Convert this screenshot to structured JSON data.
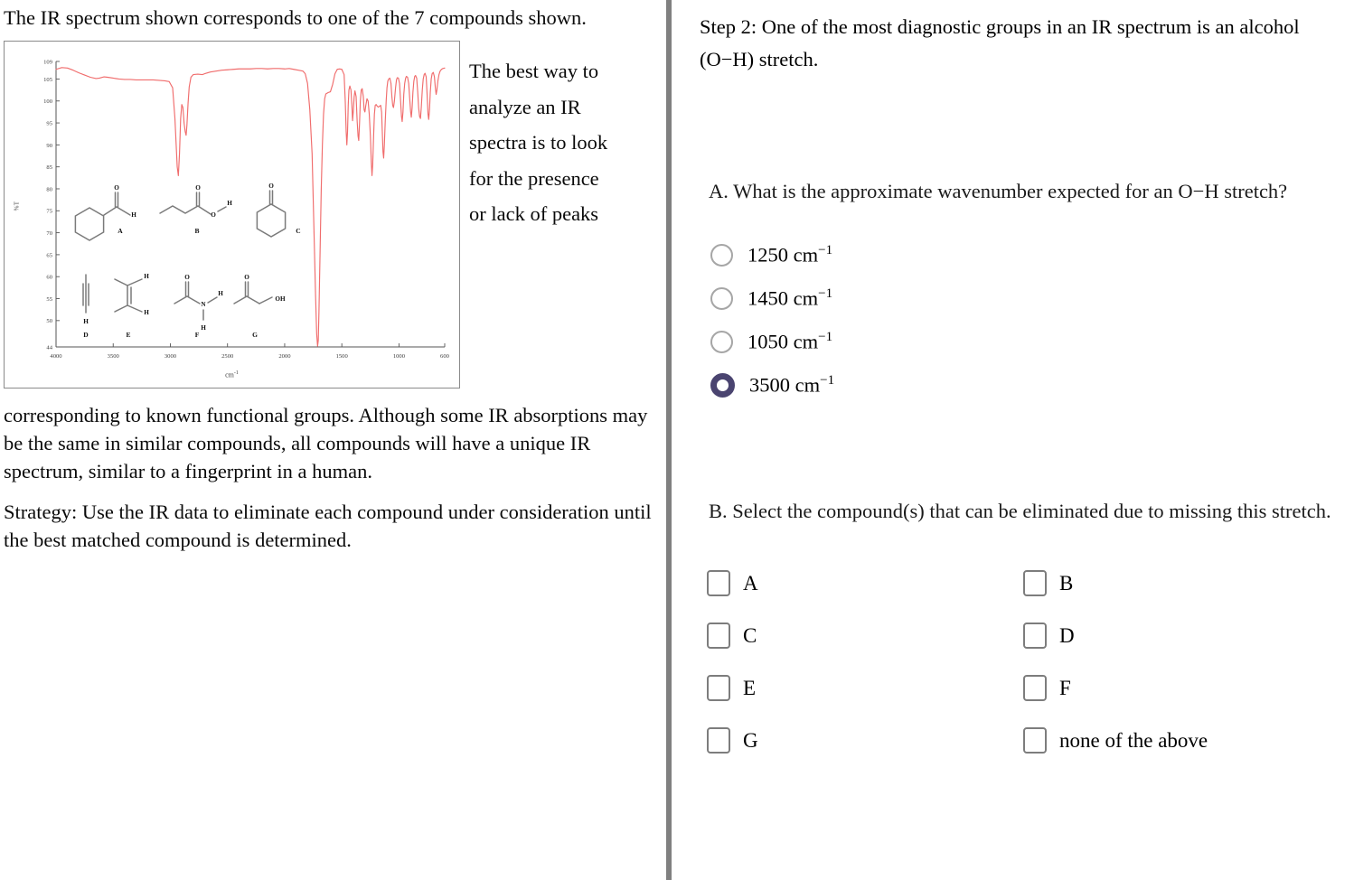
{
  "left": {
    "intro": "The IR spectrum shown corresponds to one of the 7 compounds shown.",
    "side_note": "The best way to analyze an IR spectra is to look for the presence or lack of peaks",
    "body_paragraph": "corresponding to known functional groups. Although some IR absorptions may be the same in similar compounds, all compounds will have a unique IR spectrum, similar to a fingerprint in a human.",
    "strategy_paragraph": "Strategy: Use the IR data to eliminate each compound under consideration until the best matched compound is determined."
  },
  "right": {
    "step_title": "Step 2: One of the most diagnostic groups in an IR spectrum is an alcohol (O−H) stretch.",
    "question_a": "A. What is the approximate wavenumber expected for an O−H stretch?",
    "question_b": "B. Select the compound(s) that can be eliminated due to missing this stretch.",
    "radio_options": [
      {
        "value": "1250",
        "unit": "cm",
        "exp": "−1",
        "selected": false
      },
      {
        "value": "1450",
        "unit": "cm",
        "exp": "−1",
        "selected": false
      },
      {
        "value": "1050",
        "unit": "cm",
        "exp": "−1",
        "selected": false
      },
      {
        "value": "3500",
        "unit": "cm",
        "exp": "−1",
        "selected": true
      }
    ],
    "checkbox_options": [
      {
        "label": "A",
        "checked": false
      },
      {
        "label": "B",
        "checked": false
      },
      {
        "label": "C",
        "checked": false
      },
      {
        "label": "D",
        "checked": false
      },
      {
        "label": "E",
        "checked": false
      },
      {
        "label": "F",
        "checked": false
      },
      {
        "label": "G",
        "checked": false
      },
      {
        "label": "none of the above",
        "checked": false
      }
    ],
    "selected_radio_color": "#4a4470"
  },
  "chart_data": {
    "type": "line",
    "title": "",
    "xlabel": "cm",
    "xlabel_exp": "-1",
    "ylabel": "%T",
    "xlim": [
      4000,
      600
    ],
    "ylim": [
      44,
      109
    ],
    "x_ticks": [
      4000,
      3500,
      3000,
      2500,
      2000,
      1500,
      1000,
      600
    ],
    "y_ticks": [
      44,
      50,
      55,
      60,
      65,
      70,
      75,
      80,
      85,
      90,
      95,
      100,
      105,
      109
    ],
    "grid": false,
    "legend": "none",
    "trace_color": "#f06c6c",
    "series": [
      {
        "name": "IR transmittance",
        "points": [
          [
            4000,
            107.2
          ],
          [
            3950,
            107.6
          ],
          [
            3900,
            107.5
          ],
          [
            3850,
            107.0
          ],
          [
            3800,
            106.4
          ],
          [
            3750,
            105.9
          ],
          [
            3700,
            105.4
          ],
          [
            3650,
            105.1
          ],
          [
            3620,
            105.2
          ],
          [
            3580,
            105.5
          ],
          [
            3550,
            105.4
          ],
          [
            3500,
            105.2
          ],
          [
            3450,
            105.0
          ],
          [
            3400,
            104.9
          ],
          [
            3350,
            104.9
          ],
          [
            3300,
            104.8
          ],
          [
            3250,
            104.8
          ],
          [
            3200,
            104.8
          ],
          [
            3150,
            104.8
          ],
          [
            3100,
            104.7
          ],
          [
            3050,
            104.6
          ],
          [
            3010,
            104.4
          ],
          [
            2980,
            103.0
          ],
          [
            2960,
            96.0
          ],
          [
            2940,
            85.0
          ],
          [
            2930,
            83.0
          ],
          [
            2920,
            88.0
          ],
          [
            2910,
            96.0
          ],
          [
            2900,
            99.2
          ],
          [
            2890,
            98.5
          ],
          [
            2880,
            95.0
          ],
          [
            2870,
            93.0
          ],
          [
            2862,
            92.2
          ],
          [
            2855,
            94.5
          ],
          [
            2845,
            99.5
          ],
          [
            2835,
            103.2
          ],
          [
            2820,
            105.4
          ],
          [
            2800,
            106.0
          ],
          [
            2760,
            106.1
          ],
          [
            2720,
            106.0
          ],
          [
            2700,
            106.2
          ],
          [
            2650,
            106.6
          ],
          [
            2600,
            106.8
          ],
          [
            2550,
            107.0
          ],
          [
            2500,
            107.1
          ],
          [
            2450,
            107.2
          ],
          [
            2400,
            107.3
          ],
          [
            2350,
            107.3
          ],
          [
            2300,
            107.3
          ],
          [
            2250,
            107.4
          ],
          [
            2200,
            107.4
          ],
          [
            2150,
            107.3
          ],
          [
            2100,
            107.4
          ],
          [
            2050,
            107.4
          ],
          [
            2000,
            107.3
          ],
          [
            1960,
            107.4
          ],
          [
            1920,
            107.2
          ],
          [
            1880,
            107.0
          ],
          [
            1860,
            106.9
          ],
          [
            1840,
            106.8
          ],
          [
            1820,
            106.2
          ],
          [
            1800,
            104.0
          ],
          [
            1780,
            98.0
          ],
          [
            1760,
            88.0
          ],
          [
            1745,
            72.0
          ],
          [
            1730,
            56.0
          ],
          [
            1720,
            47.0
          ],
          [
            1712,
            44.2
          ],
          [
            1706,
            45.5
          ],
          [
            1700,
            52.0
          ],
          [
            1690,
            66.0
          ],
          [
            1680,
            80.0
          ],
          [
            1670,
            90.0
          ],
          [
            1660,
            97.0
          ],
          [
            1650,
            100.5
          ],
          [
            1640,
            101.6
          ],
          [
            1620,
            101.9
          ],
          [
            1600,
            102.1
          ],
          [
            1580,
            103.8
          ],
          [
            1560,
            106.2
          ],
          [
            1540,
            107.2
          ],
          [
            1520,
            107.3
          ],
          [
            1500,
            107.2
          ],
          [
            1480,
            106.0
          ],
          [
            1470,
            100.0
          ],
          [
            1462,
            93.0
          ],
          [
            1456,
            90.0
          ],
          [
            1450,
            93.0
          ],
          [
            1444,
            99.0
          ],
          [
            1438,
            102.5
          ],
          [
            1430,
            103.4
          ],
          [
            1420,
            102.5
          ],
          [
            1412,
            99.0
          ],
          [
            1406,
            95.5
          ],
          [
            1400,
            97.5
          ],
          [
            1392,
            101.0
          ],
          [
            1385,
            102.3
          ],
          [
            1375,
            101.0
          ],
          [
            1366,
            95.5
          ],
          [
            1358,
            92.0
          ],
          [
            1352,
            91.0
          ],
          [
            1345,
            95.0
          ],
          [
            1338,
            100.0
          ],
          [
            1330,
            102.5
          ],
          [
            1322,
            102.8
          ],
          [
            1312,
            101.0
          ],
          [
            1305,
            98.0
          ],
          [
            1298,
            97.5
          ],
          [
            1290,
            99.0
          ],
          [
            1280,
            100.5
          ],
          [
            1270,
            100.0
          ],
          [
            1260,
            97.0
          ],
          [
            1250,
            92.0
          ],
          [
            1242,
            86.0
          ],
          [
            1236,
            83.0
          ],
          [
            1230,
            85.5
          ],
          [
            1222,
            92.0
          ],
          [
            1215,
            97.0
          ],
          [
            1208,
            99.0
          ],
          [
            1200,
            99.2
          ],
          [
            1190,
            98.8
          ],
          [
            1180,
            98.6
          ],
          [
            1170,
            98.8
          ],
          [
            1160,
            99.0
          ],
          [
            1152,
            97.5
          ],
          [
            1146,
            93.0
          ],
          [
            1140,
            88.5
          ],
          [
            1134,
            87.0
          ],
          [
            1128,
            90.0
          ],
          [
            1120,
            95.5
          ],
          [
            1112,
            100.0
          ],
          [
            1105,
            103.0
          ],
          [
            1098,
            104.5
          ],
          [
            1090,
            105.0
          ],
          [
            1080,
            105.2
          ],
          [
            1070,
            104.0
          ],
          [
            1062,
            101.0
          ],
          [
            1055,
            99.0
          ],
          [
            1048,
            98.5
          ],
          [
            1040,
            100.0
          ],
          [
            1030,
            103.0
          ],
          [
            1022,
            104.8
          ],
          [
            1015,
            105.3
          ],
          [
            1005,
            105.2
          ],
          [
            995,
            104.0
          ],
          [
            986,
            100.0
          ],
          [
            978,
            96.5
          ],
          [
            972,
            95.3
          ],
          [
            965,
            97.5
          ],
          [
            958,
            101.5
          ],
          [
            950,
            104.0
          ],
          [
            942,
            105.2
          ],
          [
            935,
            105.6
          ],
          [
            925,
            105.4
          ],
          [
            915,
            104.0
          ],
          [
            906,
            100.5
          ],
          [
            898,
            97.5
          ],
          [
            892,
            96.3
          ],
          [
            885,
            98.5
          ],
          [
            878,
            102.0
          ],
          [
            870,
            104.5
          ],
          [
            862,
            105.6
          ],
          [
            855,
            105.8
          ],
          [
            845,
            105.2
          ],
          [
            836,
            102.0
          ],
          [
            828,
            98.5
          ],
          [
            820,
            96.5
          ],
          [
            812,
            96.0
          ],
          [
            805,
            98.5
          ],
          [
            796,
            102.5
          ],
          [
            788,
            105.0
          ],
          [
            780,
            106.0
          ],
          [
            772,
            106.3
          ],
          [
            762,
            105.5
          ],
          [
            754,
            101.5
          ],
          [
            746,
            97.0
          ],
          [
            740,
            95.8
          ],
          [
            733,
            98.0
          ],
          [
            726,
            102.0
          ],
          [
            718,
            105.0
          ],
          [
            710,
            106.2
          ],
          [
            700,
            106.5
          ],
          [
            690,
            105.5
          ],
          [
            682,
            103.0
          ],
          [
            675,
            101.5
          ],
          [
            668,
            102.5
          ],
          [
            660,
            104.5
          ],
          [
            650,
            106.0
          ],
          [
            640,
            106.8
          ],
          [
            628,
            107.2
          ],
          [
            615,
            107.4
          ],
          [
            600,
            107.5
          ]
        ]
      }
    ],
    "compounds": [
      {
        "id": "A",
        "name": "cyclohexanecarbaldehyde"
      },
      {
        "id": "B",
        "name": "butanoic acid"
      },
      {
        "id": "C",
        "name": "cyclohexanone"
      },
      {
        "id": "D",
        "name": "terminal alkyne"
      },
      {
        "id": "E",
        "name": "2-methyl-2-butene"
      },
      {
        "id": "F",
        "name": "acetamide"
      },
      {
        "id": "G",
        "name": "hydroxyacetone"
      }
    ],
    "atom_labels": [
      "O",
      "H",
      "OH",
      "N"
    ]
  }
}
